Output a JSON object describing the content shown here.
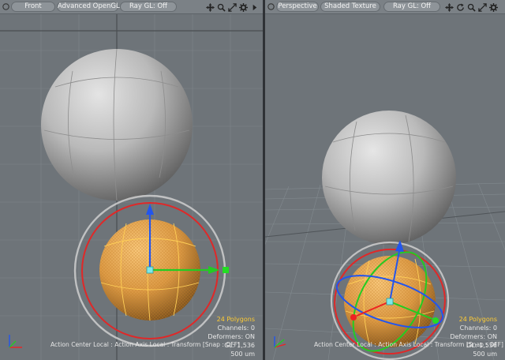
{
  "viewports": {
    "left": {
      "view_mode": "Front",
      "shading": "Advanced OpenGL",
      "ray_gl": "Ray GL: Off",
      "polygons": "24 Polygons",
      "channels": "Channels: 0",
      "deformers": "Deformers: ON",
      "status": "Action Center Local : Action Axis Local : Transform  [Snap : OFF]",
      "gl": "GL: 1,536",
      "scale": "500 um"
    },
    "right": {
      "view_mode": "Perspective",
      "shading": "Shaded Texture",
      "ray_gl": "Ray GL: Off",
      "polygons": "24 Polygons",
      "channels": "Channels: 0",
      "deformers": "Deformers: ON",
      "status": "Action Center Local : Action Axis Local : Transform  [Snap : OFF]",
      "gl": "GL: 1,536",
      "scale": "500 um"
    }
  },
  "icons": {
    "menu": "circle-menu-icon",
    "pan": "pan-arrows-icon",
    "zoom": "magnifier-zoom-icon",
    "rotate": "rotate-view-icon",
    "fit": "fit-expand-icon",
    "settings": "gear-icon",
    "more": "triangle-right-icon"
  },
  "colors": {
    "viewport_bg": "#6e7479",
    "selection": "#e9a545",
    "axis_x": "#22cc22",
    "axis_y": "#2255ee",
    "axis_z": "#ee2222",
    "highlight_text": "#ffcc33"
  }
}
